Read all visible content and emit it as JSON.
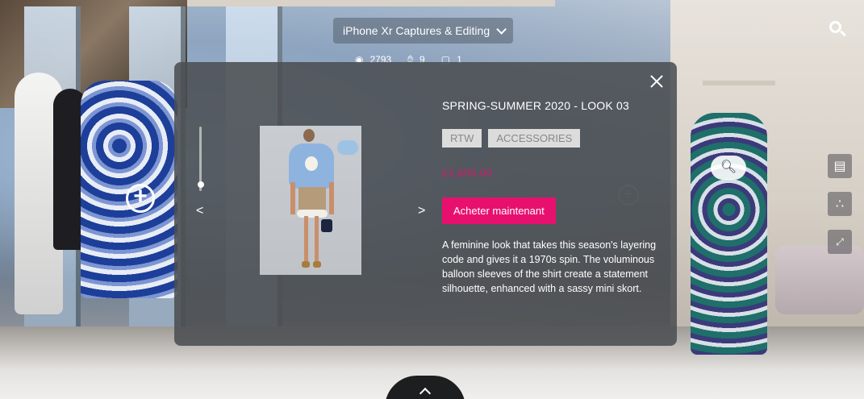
{
  "tour": {
    "title": "iPhone Xr Captures & Editing",
    "views": "2793",
    "likes": "9",
    "comments": "1"
  },
  "modal": {
    "product_title": "SPRING-SUMMER 2020 - LOOK 03",
    "tags": [
      "RTW",
      "ACCESSORIES"
    ],
    "price": "£1,650.00",
    "buy_label": "Acheter maintenant",
    "description": "A feminine look that takes this season's layering code and gives it a 1970s spin. The voluminous balloon sleeves of the shirt create a statement silhouette, enhanced with a sassy mini skort.",
    "prev_label": "<",
    "next_label": ">",
    "zoom_level": 0.05
  },
  "colors": {
    "accent": "#e8106f",
    "modal_bg": "#4b4e52",
    "tag_bg": "#dcdcdc"
  },
  "icons": {
    "search": "search-icon",
    "views": "eye-icon",
    "likes": "thumbs-up-icon",
    "comments": "comment-icon",
    "floorplan": "floorplan-icon",
    "share": "share-icon",
    "fullscreen": "fullscreen-icon",
    "close": "close-icon",
    "expand": "chevron-up-icon"
  }
}
